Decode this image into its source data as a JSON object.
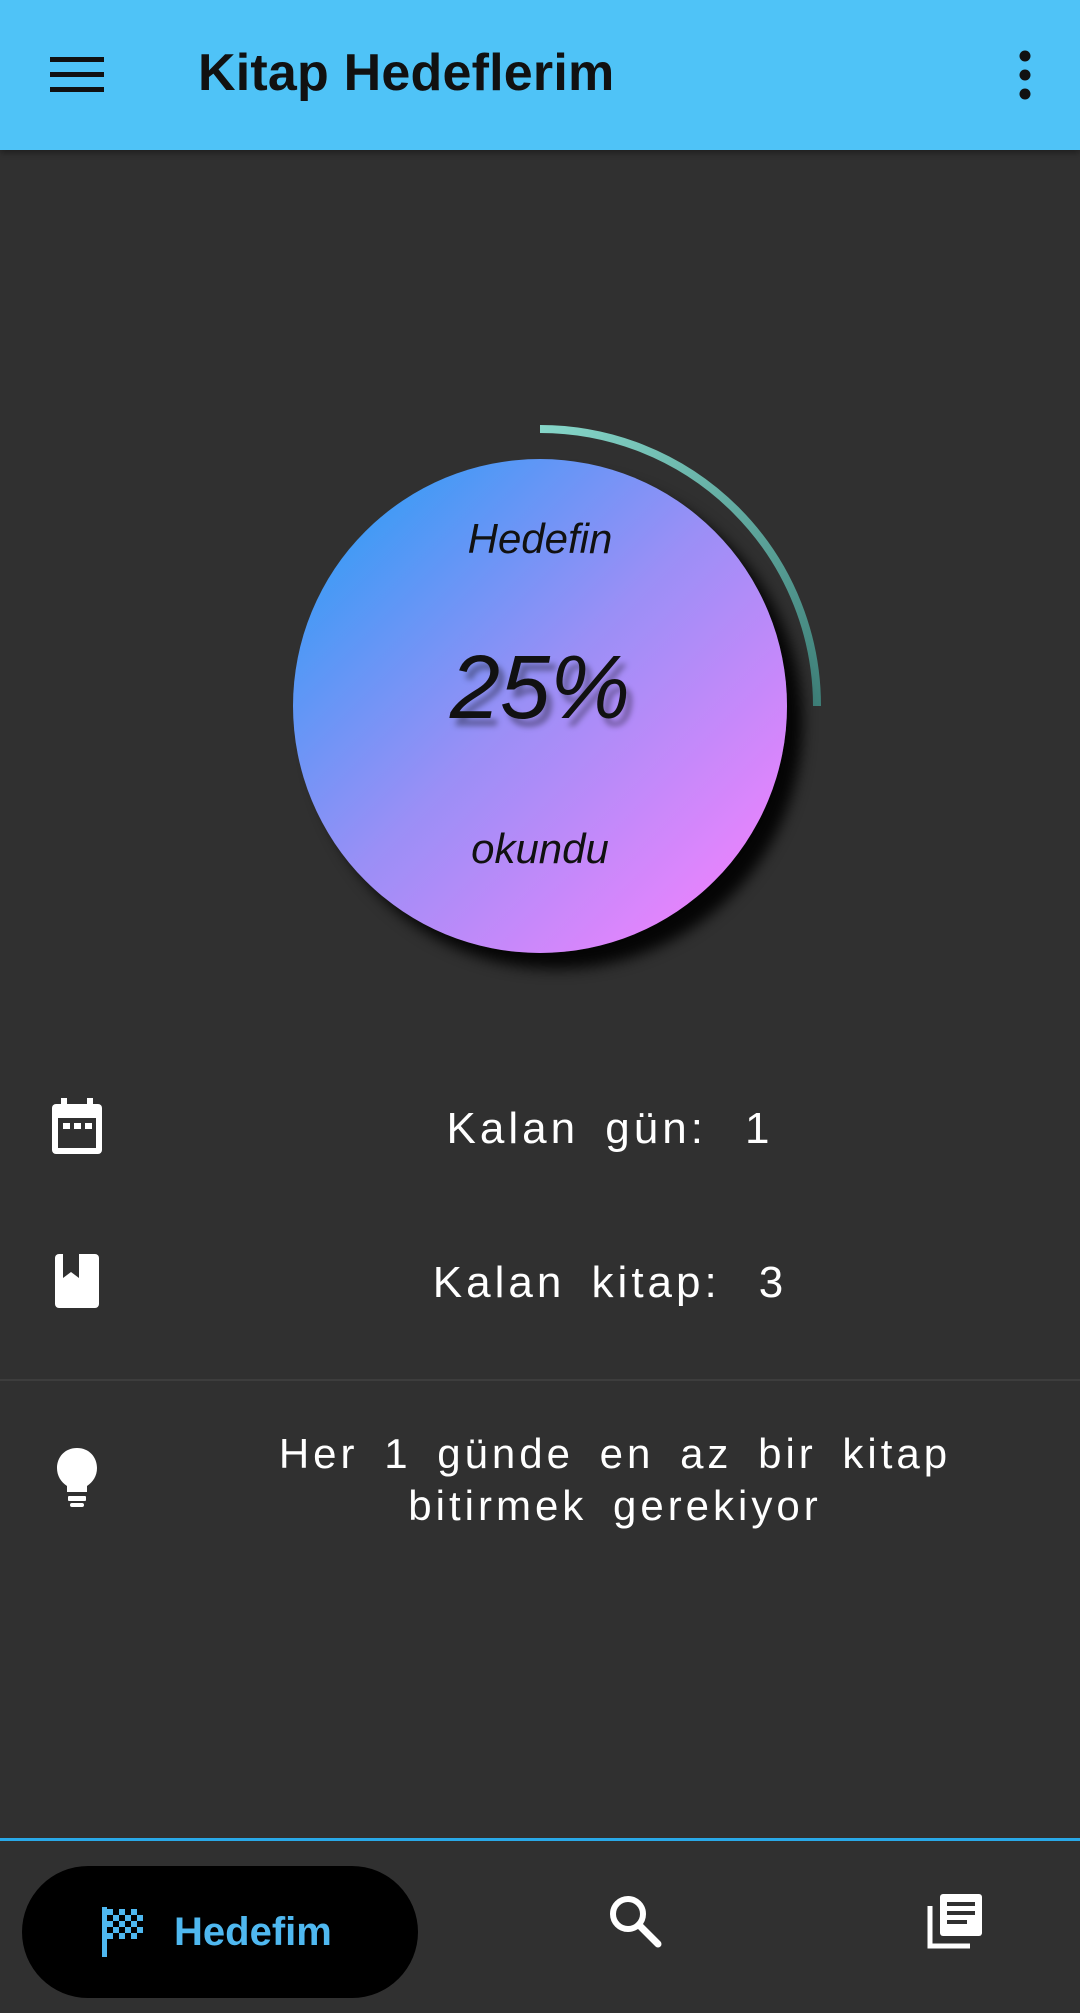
{
  "app_bar": {
    "title": "Kitap Hedeflerim",
    "color": "#4FC3F7",
    "left_icon": "menu-icon",
    "right_icon": "more-vert-icon"
  },
  "progress": {
    "label_top": "Hedefin",
    "percent_text": "25%",
    "percent_value": 25,
    "label_bottom": "okundu",
    "ring_color": "#7ECDC0"
  },
  "stats": {
    "remaining_days": {
      "label": "Kalan gün:",
      "value": "1",
      "icon": "calendar-icon"
    },
    "remaining_books": {
      "label": "Kalan kitap:",
      "value": "3",
      "icon": "book-icon"
    }
  },
  "tip": {
    "icon": "lightbulb-icon",
    "text": "Her 1 günde en az bir kitap bitirmek gerekiyor"
  },
  "bottom_nav": {
    "accent": "#4FB8F0",
    "items": [
      {
        "label": "Hedefim",
        "icon": "flag-icon",
        "active": true
      },
      {
        "label": "",
        "icon": "search-icon",
        "active": false
      },
      {
        "label": "",
        "icon": "library-icon",
        "active": false
      }
    ]
  }
}
